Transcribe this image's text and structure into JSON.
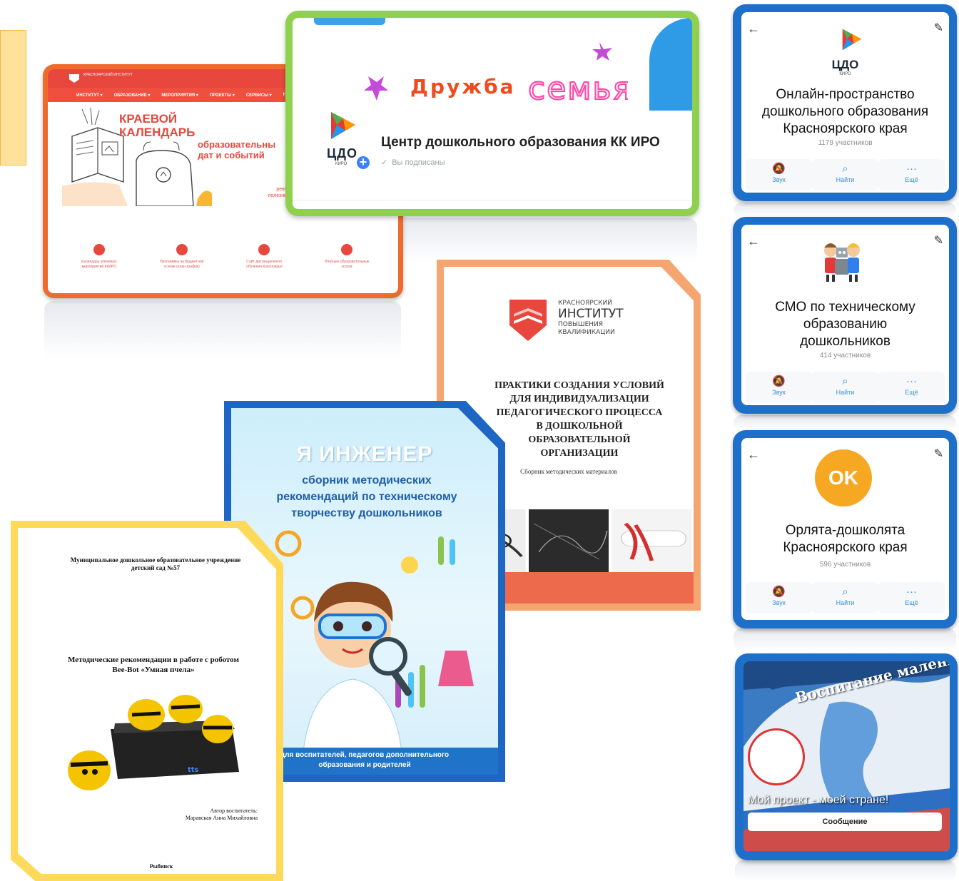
{
  "site_card": {
    "nav": [
      "ИНСТИТУТ ▾",
      "ОБРАЗОВАНИЕ ▾",
      "МЕРОПРИЯТИЯ ▾",
      "ПРОЕКТЫ ▾",
      "СЕРВИСЫ ▾",
      "НА"
    ],
    "logo_text": "КРАСНОЯРСКИЙ ИНСТИТУТ",
    "hero_title_1": "КРАЕВОЙ",
    "hero_title_2": "КАЛЕНДАРЬ",
    "hero_sub_1": "образовательны",
    "hero_sub_2": "дат и событий",
    "hero_side": "реком полезные",
    "links": [
      {
        "line1": "Календарь ключевых",
        "line2": "мероприятий ККИРО"
      },
      {
        "line1": "Программы на бюджетной",
        "line2": "основе (план-график)"
      },
      {
        "line1": "Сайт дистанционного",
        "line2": "обучения Красноярья"
      },
      {
        "line1": "Платные образовательные",
        "line2": "услуги"
      }
    ]
  },
  "center_card": {
    "banner_1": "Дружба",
    "banner_2": "семья",
    "logo_text": "ЦДО",
    "logo_sub": "КИРО",
    "plus": "+",
    "title": "Центр дошкольного образования КК ИРО",
    "check": "✓",
    "status": "Вы подписаны"
  },
  "channels": [
    {
      "logo_text": "ЦДО",
      "logo_sub": "КИРО",
      "title": [
        "Онлайн-пространство",
        "дошкольного образования",
        "Красноярского края"
      ],
      "members": "1179 участников",
      "actions": [
        {
          "icon": "bell-off-icon",
          "glyph": "🔕",
          "label": "Звук"
        },
        {
          "icon": "search-icon",
          "glyph": "⌕",
          "label": "Найти"
        },
        {
          "icon": "more-icon",
          "glyph": "···",
          "label": "Ещё"
        }
      ]
    },
    {
      "title": [
        "СМО по техническому",
        "образованию",
        "дошкольников"
      ],
      "members": "414 участников",
      "actions": [
        {
          "icon": "bell-off-icon",
          "glyph": "🔕",
          "label": "Звук"
        },
        {
          "icon": "search-icon",
          "glyph": "⌕",
          "label": "Найти"
        },
        {
          "icon": "more-icon",
          "glyph": "···",
          "label": "Ещё"
        }
      ]
    },
    {
      "avatar": "OK",
      "title": [
        "Орлята-дошколята",
        "Красноярского края"
      ],
      "members": "596 участников",
      "actions": [
        {
          "icon": "bell-off-icon",
          "glyph": "🔕",
          "label": "Звук"
        },
        {
          "icon": "search-icon",
          "glyph": "⌕",
          "label": "Найти"
        },
        {
          "icon": "more-icon",
          "glyph": "···",
          "label": "Ещё"
        }
      ]
    }
  ],
  "icons": {
    "back": "←",
    "edit": "✎"
  },
  "map_card": {
    "banner": "Воспитание маленького",
    "caption": "Мой проект - моей стране!",
    "button": "Сообщение"
  },
  "practice_doc": {
    "inst_line1": "КРАСНОЯРСКИЙ",
    "inst_line2": "ИНСТИТУТ",
    "inst_line3": "ПОВЫШЕНИЯ",
    "inst_line4": "КВАЛИФИКАЦИИ",
    "title": [
      "ПРАКТИКИ СОЗДАНИЯ УСЛОВИЙ",
      "ДЛЯ ИНДИВИДУАЛИЗАЦИИ",
      "ПЕДАГОГИЧЕСКОГО ПРОЦЕССА",
      "В ДОШКОЛЬНОЙ",
      "ОБРАЗОВАТЕЛЬНОЙ",
      "ОРГАНИЗАЦИИ"
    ],
    "subtitle": "Сборник методических материалов"
  },
  "engineer_doc": {
    "title": "Я ИНЖЕНЕР",
    "subtitle": [
      "сборник методических",
      "рекомендаций по техническому",
      "творчеству дошкольников"
    ],
    "bottom_1": "для воспитателей, педагогов дополнительного",
    "bottom_2": "образования и родителей"
  },
  "beebot_doc": {
    "org_1": "Муниципальное дошкольное образовательное учреждение",
    "org_2": "детский сад №57",
    "title_1": "Методические рекомендации в работе с роботом",
    "title_2": "Bee-Bot «Умная пчела»",
    "author_1": "Автор воспитатель:",
    "author_2": "Маравская Анна Михайловна",
    "city": "Рыбинск",
    "robot_label": "tts"
  }
}
